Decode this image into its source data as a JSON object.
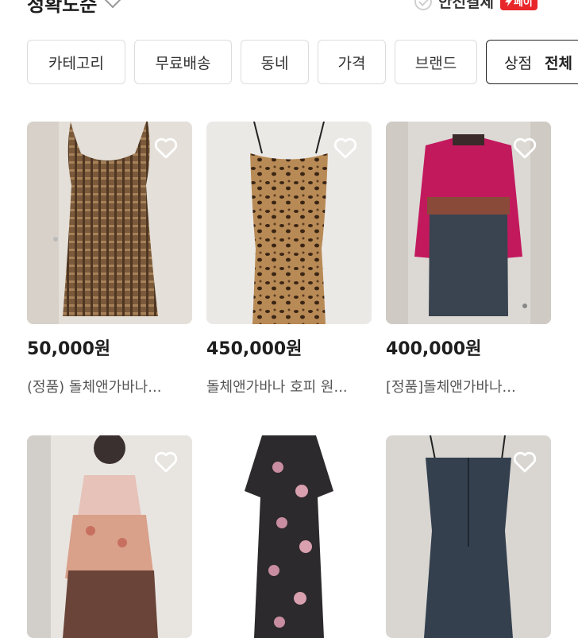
{
  "header": {
    "sort_label": "정확도순",
    "safe_pay_label": "안전결제",
    "pay_badge": "페이"
  },
  "filters": [
    {
      "label": "카테고리"
    },
    {
      "label": "무료배송"
    },
    {
      "label": "동네"
    },
    {
      "label": "가격"
    },
    {
      "label": "브랜드"
    }
  ],
  "store_filter": {
    "label": "상점",
    "value": "전체"
  },
  "products": [
    {
      "price": "50,000원",
      "title": "(정품) 돌체앤가바나..."
    },
    {
      "price": "450,000원",
      "title": "돌체앤가바나 호피 원..."
    },
    {
      "price": "400,000원",
      "title": "[정품]돌체앤가바나..."
    },
    {
      "price": "",
      "title": ""
    },
    {
      "price": "",
      "title": ""
    },
    {
      "price": "",
      "title": ""
    }
  ],
  "colors": {
    "brand_red": "#e8272b",
    "chip_border": "#dcdcdc",
    "active_chip_border": "#222222"
  },
  "icons": {
    "favorite": "heart-outline-icon",
    "safe_pay": "check-circle-icon",
    "sort": "chevron-down-icon",
    "pay": "lightning-icon"
  }
}
